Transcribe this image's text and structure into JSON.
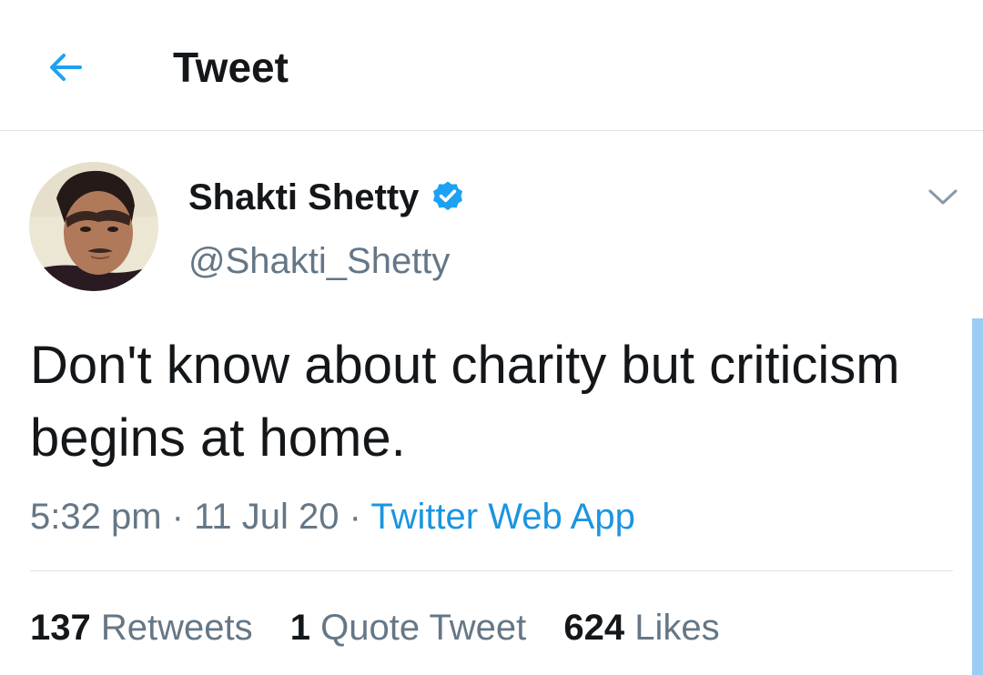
{
  "header": {
    "title": "Tweet",
    "back_icon": "back-arrow-icon"
  },
  "author": {
    "display_name": "Shakti Shetty",
    "handle": "@Shakti_Shetty",
    "verified": true,
    "verified_icon": "verified-badge-icon"
  },
  "tweet": {
    "text": "Don't know about charity but criticism begins at home.",
    "time": "5:32 pm",
    "date": "11 Jul 20",
    "source": "Twitter Web App",
    "separator": "·"
  },
  "stats": {
    "retweets_count": "137",
    "retweets_label": "Retweets",
    "quotes_count": "1",
    "quotes_label": "Quote Tweet",
    "likes_count": "624",
    "likes_label": "Likes"
  },
  "colors": {
    "accent": "#1da1f2",
    "link": "#1b95e0",
    "secondary_text": "#657786",
    "primary_text": "#14171a",
    "divider": "#dfe3e6"
  }
}
